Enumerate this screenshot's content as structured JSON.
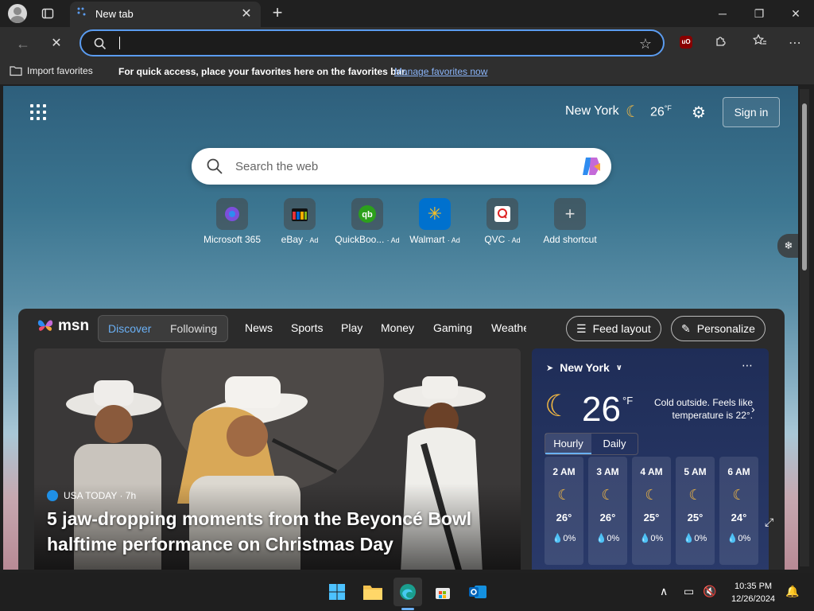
{
  "window": {
    "tab_title": "New tab",
    "new_tab_label": "+",
    "minimize": "─",
    "restore": "❐",
    "close": "✕"
  },
  "toolbar": {
    "address_value": "",
    "back": "←",
    "stop": "✕",
    "favorite_star": "☆",
    "extension_ublock": "uO"
  },
  "favorites_bar": {
    "import_label": "Import favorites",
    "message": "For quick access, place your favorites here on the favorites bar.",
    "manage_link": "Manage favorites now"
  },
  "page": {
    "city": "New York",
    "temperature": "26",
    "temperature_unit": "°F",
    "sign_in": "Sign in",
    "search_placeholder": "Search the web",
    "shortcuts": [
      {
        "label": "Microsoft 365",
        "ad": ""
      },
      {
        "label": "eBay",
        "ad": "· Ad"
      },
      {
        "label": "QuickBoo...",
        "ad": "· Ad"
      },
      {
        "label": "Walmart",
        "ad": "· Ad"
      },
      {
        "label": "QVC",
        "ad": "· Ad"
      },
      {
        "label": "Add shortcut",
        "ad": ""
      }
    ]
  },
  "feed": {
    "brand": "msn",
    "discover": "Discover",
    "following": "Following",
    "tabs": [
      "News",
      "Sports",
      "Play",
      "Money",
      "Gaming",
      "Weathe"
    ],
    "feed_layout": "Feed layout",
    "personalize": "Personalize",
    "hero": {
      "source": "USA TODAY · 7h",
      "title": "5 jaw-dropping moments from the Beyoncé Bowl halftime performance on Christmas Day"
    },
    "weather": {
      "city": "New York",
      "temp": "26",
      "unit": "°F",
      "description": "Cold outside. Feels like temperature is 22°.",
      "tab_hourly": "Hourly",
      "tab_daily": "Daily",
      "hours": [
        {
          "time": "2 AM",
          "temp": "26°",
          "precip": "0%"
        },
        {
          "time": "3 AM",
          "temp": "26°",
          "precip": "0%"
        },
        {
          "time": "4 AM",
          "temp": "25°",
          "precip": "0%"
        },
        {
          "time": "5 AM",
          "temp": "25°",
          "precip": "0%"
        },
        {
          "time": "6 AM",
          "temp": "24°",
          "precip": "0%"
        }
      ]
    }
  },
  "taskbar": {
    "time": "10:35 PM",
    "date": "12/26/2024"
  },
  "colors": {
    "accent": "#5b9cf0",
    "moon": "#f4b942",
    "chrome": "#202020"
  }
}
